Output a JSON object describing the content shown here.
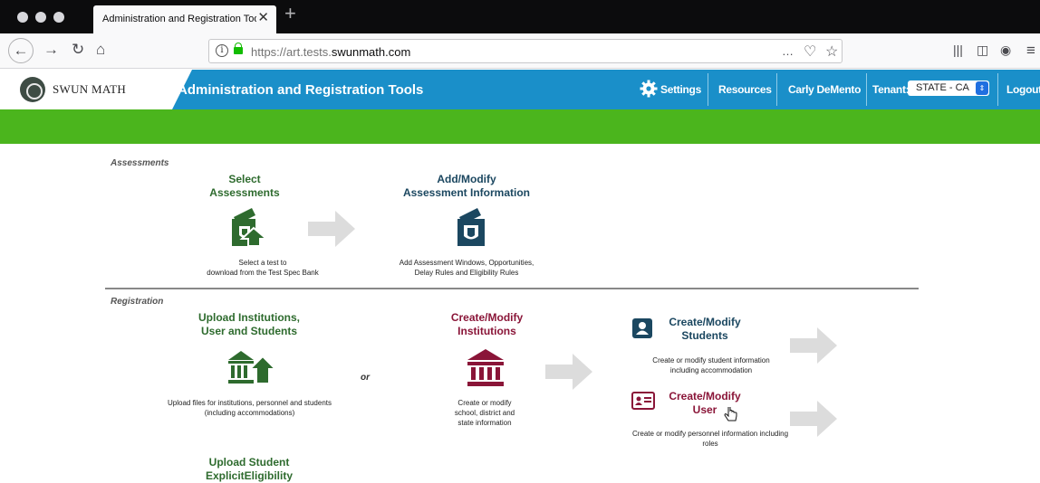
{
  "browser": {
    "tab_title": "Administration and Registration Too",
    "url_prefix": "https://art.tests.",
    "url_domain": "swunmath.com",
    "url_overflow_icon": "…",
    "icons": [
      "back-icon",
      "forward-icon",
      "reload-icon",
      "home-icon",
      "info-icon",
      "lock-icon",
      "pocket-icon",
      "bookmark-star-icon",
      "library-icon",
      "sidebar-icon",
      "account-icon",
      "menu-icon"
    ]
  },
  "header": {
    "logo_text": "SWUN MATH",
    "title": "Administration and Registration Tools",
    "settings": "Settings",
    "resources": "Resources",
    "user": "Carly DeMento",
    "tenant_label": "Tenant:",
    "tenant_value": "STATE - CA",
    "logout": "Logout",
    "colors": {
      "header_blue": "#1a8fc9",
      "green_bar": "#4bb51d"
    }
  },
  "assessments": {
    "section_label": "Assessments",
    "select": {
      "title_line1": "Select",
      "title_line2": "Assessments",
      "desc_line1": "Select a test to",
      "desc_line2": "download from the Test Spec Bank"
    },
    "modify": {
      "title_line1": "Add/Modify",
      "title_line2": "Assessment Information",
      "desc_line1": "Add Assessment Windows, Opportunities,",
      "desc_line2": "Delay Rules and Eligibility Rules"
    }
  },
  "registration": {
    "section_label": "Registration",
    "upload": {
      "title_line1": "Upload Institutions,",
      "title_line2": "User and Students",
      "desc_line1": "Upload files for institutions, personnel and students",
      "desc_line2": "(including accommodations)"
    },
    "or_text": "or",
    "institutions": {
      "title_line1": "Create/Modify",
      "title_line2": "Institutions",
      "desc_line1": "Create or modify",
      "desc_line2": "school, district and",
      "desc_line3": "state information"
    },
    "students": {
      "title_line1": "Create/Modify",
      "title_line2": "Students",
      "desc_line1": "Create or modify student information",
      "desc_line2": "including accommodation"
    },
    "user": {
      "title_line1": "Create/Modify",
      "title_line2": "User",
      "desc_line1": "Create or modify personnel information including",
      "desc_line2": "roles"
    },
    "upload_eligibility": {
      "title_line1": "Upload Student",
      "title_line2": "ExplicitEligibility"
    }
  }
}
